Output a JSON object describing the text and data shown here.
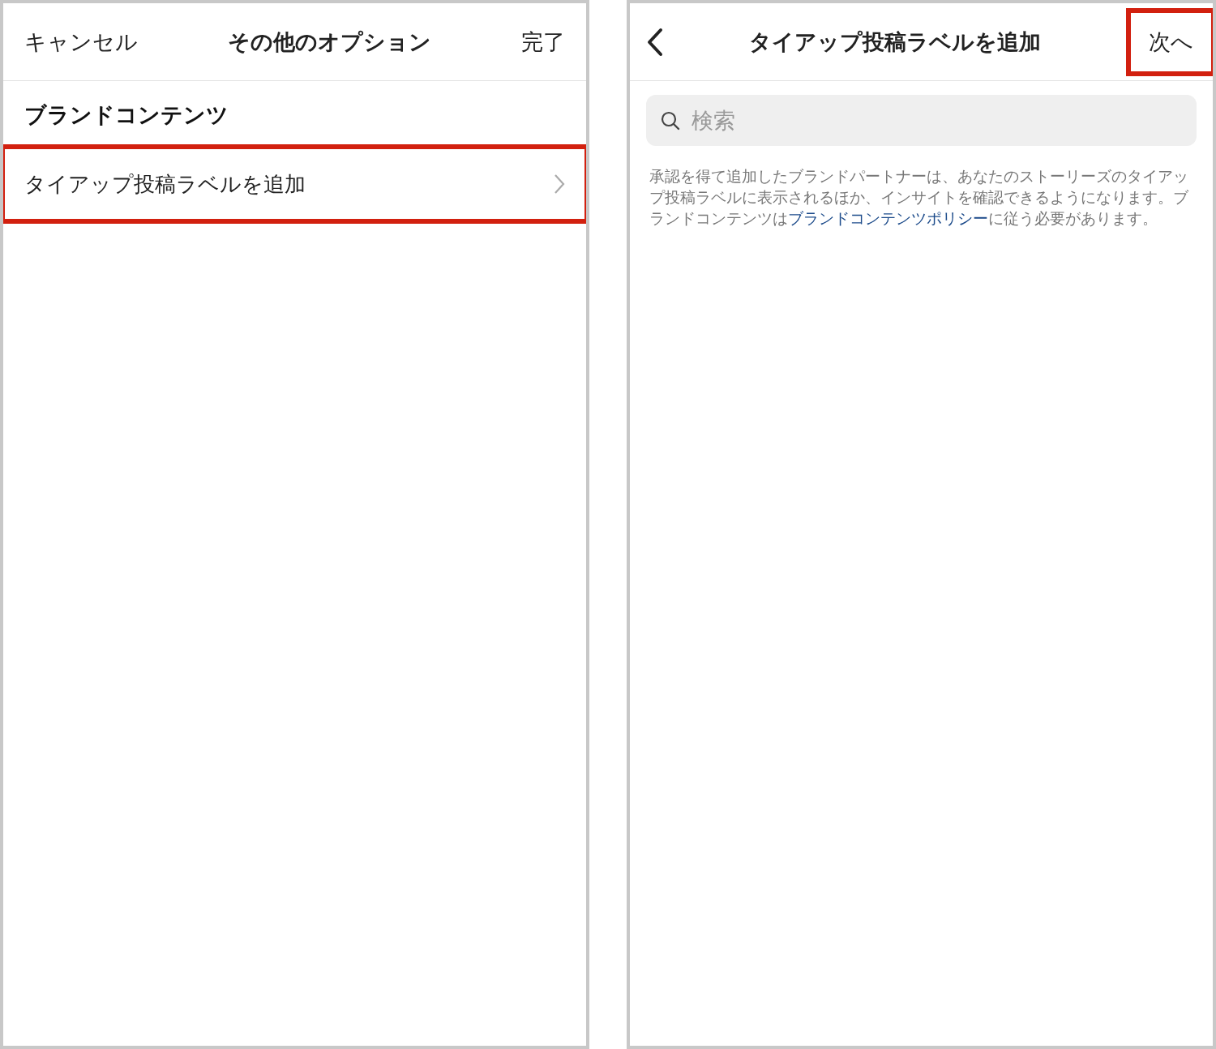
{
  "left_screen": {
    "header": {
      "cancel": "キャンセル",
      "title": "その他のオプション",
      "done": "完了"
    },
    "section_title": "ブランドコンテンツ",
    "rows": [
      {
        "label": "タイアップ投稿ラベルを追加",
        "highlighted": true
      }
    ]
  },
  "right_screen": {
    "header": {
      "title": "タイアップ投稿ラベルを追加",
      "next": "次へ",
      "next_highlighted": true
    },
    "search": {
      "placeholder": "検索"
    },
    "description": {
      "text_before": "承認を得て追加したブランドパートナーは、あなたのストーリーズのタイアップ投稿ラベルに表示されるほか、インサイトを確認できるようになります。ブランドコンテンツは",
      "link": "ブランドコンテンツポリシー",
      "text_after": "に従う必要があります。"
    }
  }
}
